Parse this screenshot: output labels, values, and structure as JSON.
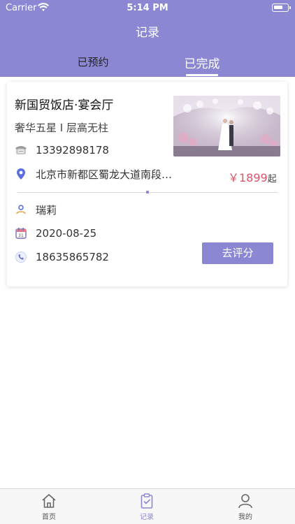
{
  "status_bar": {
    "carrier": "Carrier",
    "time": "5:14 PM"
  },
  "nav": {
    "title": "记录"
  },
  "tabs": [
    {
      "label": "已预约",
      "active": false
    },
    {
      "label": "已完成",
      "active": true
    }
  ],
  "record": {
    "venue_name": "新国贸饭店·宴会厅",
    "venue_tags": "奢华五星 I 层高无柱",
    "venue_phone": "13392898178",
    "address": "北京市新都区蜀龙大道南段…",
    "price": "￥1899",
    "price_suffix": "起",
    "contact_name": "瑞莉",
    "date": "2020-08-25",
    "contact_phone": "18635865782",
    "review_button": "去评分"
  },
  "tabbar": [
    {
      "label": "首页",
      "icon": "home-icon",
      "active": false
    },
    {
      "label": "记录",
      "icon": "clipboard-check-icon",
      "active": true
    },
    {
      "label": "我的",
      "icon": "person-icon",
      "active": false
    }
  ],
  "colors": {
    "accent": "#8c87d2",
    "price": "#d9566a"
  }
}
